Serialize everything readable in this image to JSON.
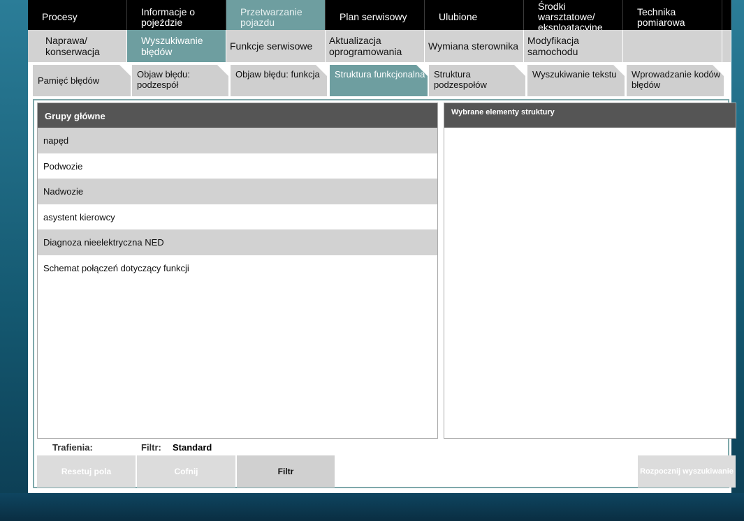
{
  "nav_main": [
    "Procesy",
    "Informacje o pojeździe",
    "Przetwarzanie pojazdu",
    "Plan serwisowy",
    "Ulubione",
    "Środki warsztatowe/ eksploatacyjne",
    "Technika pomiarowa"
  ],
  "nav_sub": [
    "Naprawa/ konserwacja",
    "Wyszukiwanie błędów",
    "Funkcje serwisowe",
    "Aktualizacja oprogramowania",
    "Wymiana sterownika",
    "Modyfikacja samochodu"
  ],
  "tabs": [
    "Pamięć błędów",
    "Objaw błędu: podzespół",
    "Objaw błędu: funkcja",
    "Struktura funkcjonalna",
    "Struktura podzespołów",
    "Wyszukiwanie tekstu",
    "Wprowadzanie kodów błędów"
  ],
  "left_panel": {
    "header": "Grupy główne",
    "items": [
      "napęd",
      "Podwozie",
      "Nadwozie",
      "asystent kierowcy",
      "Diagnoza nieelektryczna NED",
      "Schemat połączeń dotyczący funkcji"
    ]
  },
  "right_panel": {
    "header": "Wybrane elementy struktury"
  },
  "status": {
    "hits_label": "Trafienia:",
    "filter_label": "Filtr:",
    "filter_value": "Standard"
  },
  "buttons": {
    "reset": "Resetuj pola",
    "undo": "Cofnij",
    "filter": "Filtr",
    "start": "Rozpocznij wyszukiwanie"
  },
  "colors": {
    "accent": "#6e9ea0",
    "header_dark": "#555555",
    "row_alt": "#d2d2d2"
  }
}
